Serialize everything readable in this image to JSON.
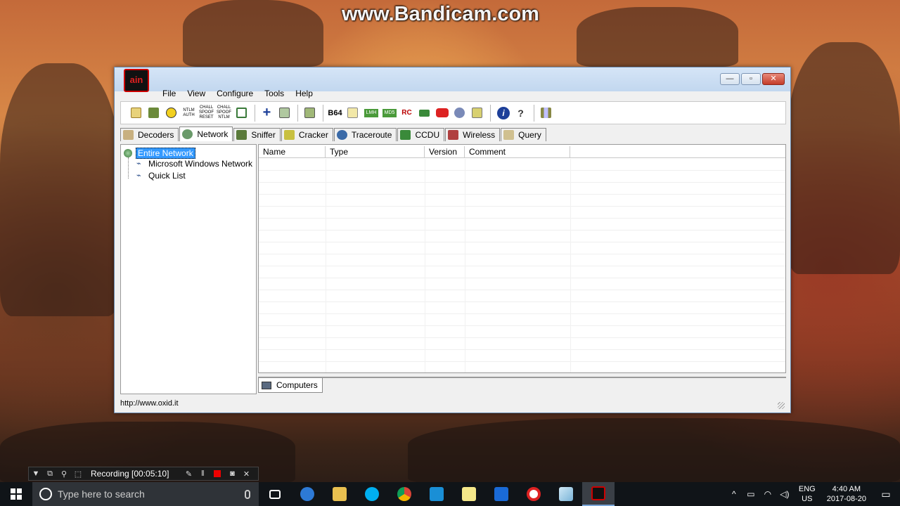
{
  "watermark": "www.Bandicam.com",
  "app": {
    "icon_text": "ain",
    "window_buttons": {
      "minimize": "—",
      "maximize": "▫",
      "close": "✕"
    },
    "menu": [
      "File",
      "View",
      "Configure",
      "Tools",
      "Help"
    ],
    "toolbar_icons": [
      "open-folder",
      "network-card",
      "radioactive",
      "ntlm-auth",
      "chall-spoof-reset",
      "chall-spoof-ntlm",
      "monitor",
      "add",
      "delete",
      "refresh",
      "base64",
      "edit",
      "lm-hash",
      "md5-hash",
      "rc-tool",
      "screen",
      "record",
      "settings",
      "lock",
      "info",
      "help",
      "dialup"
    ],
    "toolbar_text": {
      "ntlm": "NTLM AUTH",
      "chall1": "CHALL SPOOF RESET",
      "chall2": "CHALL SPOOF NTLM",
      "b64": "B64",
      "lmh": "LMH",
      "md5": "MD5",
      "rc": "RC"
    },
    "tabs": [
      "Decoders",
      "Network",
      "Sniffer",
      "Cracker",
      "Traceroute",
      "CCDU",
      "Wireless",
      "Query"
    ],
    "active_tab": "Network",
    "tree": {
      "root": "Entire Network",
      "children": [
        "Microsoft Windows Network",
        "Quick List"
      ]
    },
    "columns": [
      "Name",
      "Type",
      "Version",
      "Comment"
    ],
    "bottom_tab": "Computers",
    "status": "http://www.oxid.it"
  },
  "recording": {
    "text": "Recording [00:05:10]"
  },
  "taskbar": {
    "search_placeholder": "Type here to search",
    "lang_top": "ENG",
    "lang_bottom": "US",
    "time": "4:40 AM",
    "date": "2017-08-20"
  },
  "colors": {
    "selection": "#3399ff",
    "taskbar": "#101418",
    "accent": "#7aa7d9"
  }
}
